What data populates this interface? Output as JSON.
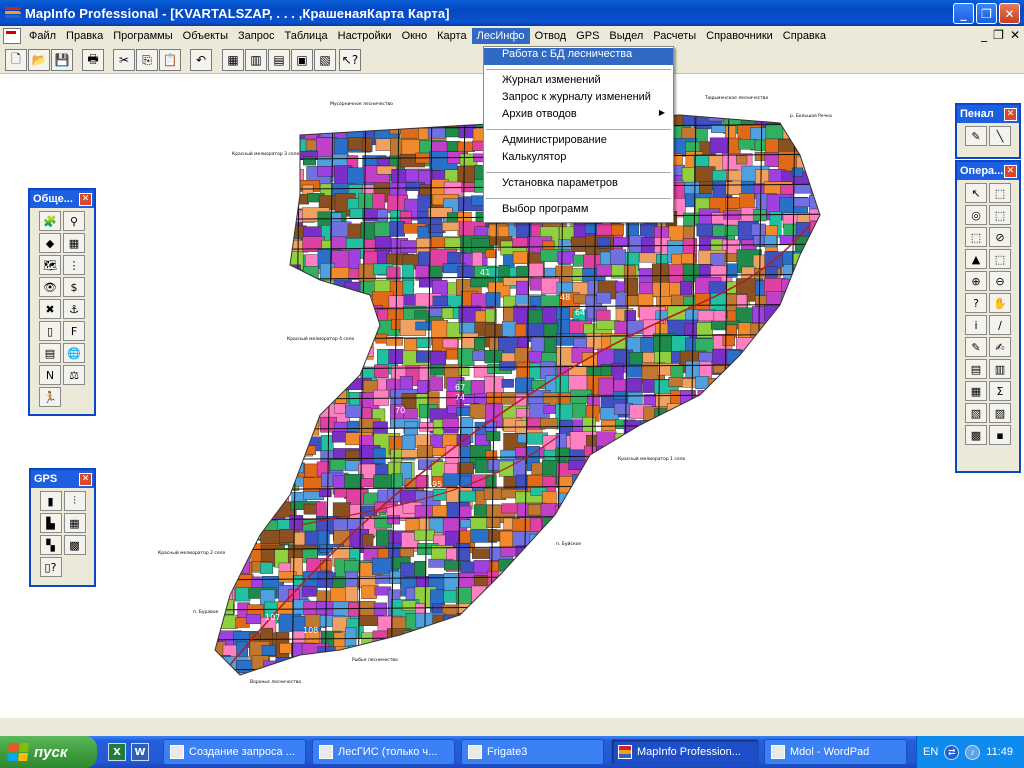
{
  "window": {
    "title": "MapInfo Professional - [KVARTALSZAP, . . . ,КрашенаяКарта Карта]",
    "min_glyph": "_",
    "max_glyph": "❐",
    "close_glyph": "✕"
  },
  "menubar": {
    "items": [
      "Файл",
      "Правка",
      "Программы",
      "Объекты",
      "Запрос",
      "Таблица",
      "Настройки",
      "Окно",
      "Карта",
      "ЛесИнфо",
      "Отвод",
      "GPS",
      "Выдел",
      "Расчеты",
      "Справочники",
      "Справка"
    ],
    "active_item": "ЛесИнфо",
    "mdi_controls": [
      "_",
      "❐",
      "✕"
    ]
  },
  "toolbar": {
    "buttons": [
      "new-icon",
      "open-icon",
      "save-icon",
      "print-icon",
      "cut-icon",
      "copy-icon",
      "paste-icon",
      "undo-icon",
      "new-browser-icon",
      "new-mapper-icon",
      "new-grapher-icon",
      "new-layout-icon",
      "redistrict-icon",
      "help-pointer-icon"
    ],
    "glyphs": [
      "🗋",
      "📂",
      "💾",
      "🖶",
      "✂",
      "⎘",
      "📋",
      "↶",
      "▦",
      "▥",
      "▤",
      "▣",
      "▧",
      "↖?"
    ]
  },
  "lesinfo_menu": {
    "items": [
      {
        "label": "Работа с БД лесничества",
        "selected": true
      },
      {
        "separator": true
      },
      {
        "label": "Журнал изменений"
      },
      {
        "label": "Запрос к журналу изменений"
      },
      {
        "label": "Архив отводов",
        "submenu": true
      },
      {
        "separator": true
      },
      {
        "label": "Администрирование"
      },
      {
        "label": "Калькулятор"
      },
      {
        "separator": true
      },
      {
        "label": "Установка параметров"
      },
      {
        "separator": true
      },
      {
        "label": "Выбор программ"
      }
    ],
    "submenu_arrow": "▶"
  },
  "palettes": {
    "general": {
      "title": "Обще...",
      "close": "✕",
      "glyphs": [
        "🧩",
        "⚲",
        "◆",
        "▦",
        "🗺",
        "⋮",
        "👁",
        "$",
        "✖",
        "⚓",
        "▯",
        "F",
        "▤",
        "🌐",
        "N",
        "⚖",
        "🏃"
      ]
    },
    "gps": {
      "title": "GPS",
      "close": "✕",
      "glyphs": [
        "▮",
        "⫶",
        "▙",
        "▦",
        "▚",
        "▩",
        "▯?"
      ]
    },
    "penal": {
      "title": "Пенал",
      "close": "✕",
      "glyphs": [
        "✎",
        "╲"
      ]
    },
    "operations": {
      "title": "Опера...",
      "close": "✕",
      "glyphs": [
        "↖",
        "⬚",
        "◎",
        "⬚",
        "⬚",
        "⊘",
        "▲",
        "⬚",
        "⊕",
        "⊖",
        "?",
        "✋",
        "i",
        "∕",
        "✎",
        "✍",
        "▤",
        "▥",
        "▦",
        "Σ",
        "▧",
        "▨",
        "▩",
        "▪"
      ]
    }
  },
  "map": {
    "labels_small": [
      "Мусорничное лесничество",
      "Тюрьменское лесничество",
      "р. Большая Речка",
      "Красный мелиоратор 3 село",
      "Красный мелиоратор 4 село",
      "Красный мелиоратор 1 село",
      "Красный мелиоратор 2 село",
      "п. Буйское",
      "п. Буравое",
      "Воронье лесничество",
      "Рыбье лесничество"
    ],
    "block_numbers": [
      "41",
      "48",
      "64",
      "67",
      "70",
      "74",
      "95",
      "107",
      "108"
    ]
  },
  "taskbar": {
    "start_label": "пуск",
    "quick_launch": [
      "X",
      "W"
    ],
    "tasks": [
      {
        "label": "Создание запроса ..."
      },
      {
        "label": "ЛесГИС (только ч..."
      },
      {
        "label": "Frigate3"
      },
      {
        "label": "MapInfo Profession...",
        "active": true
      },
      {
        "label": "Mdol - WordPad"
      }
    ],
    "tray": {
      "lang": "EN",
      "clock": "11:49"
    }
  },
  "colors": {
    "selection": "#316ac5",
    "xp_blue": "#0a52d0",
    "menu_bg": "#ece9d8"
  }
}
